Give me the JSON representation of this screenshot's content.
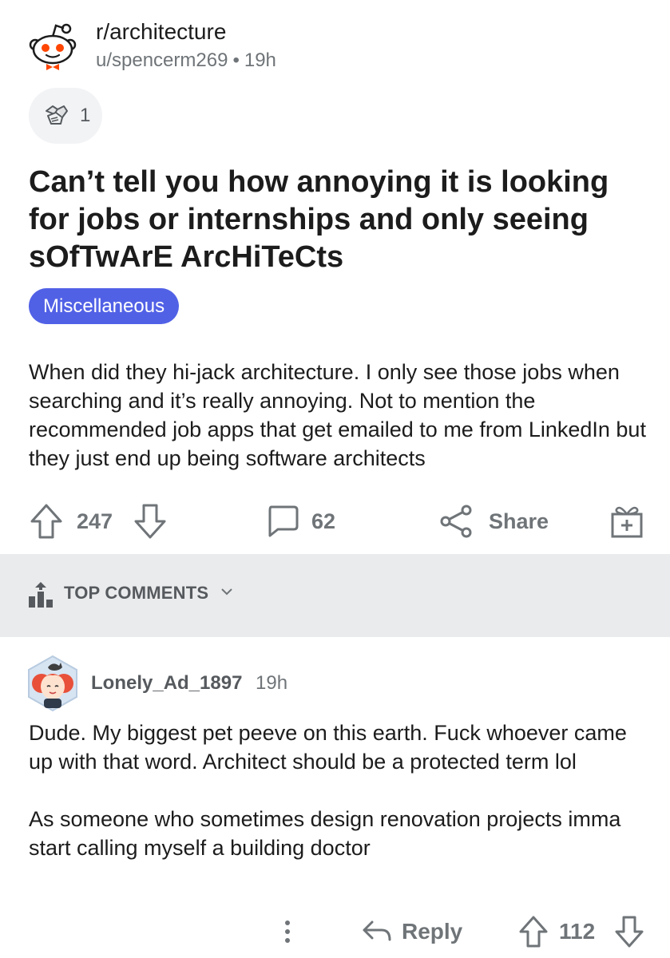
{
  "post": {
    "subreddit": "r/architecture",
    "author": "u/spencerm269",
    "separator": "•",
    "age": "19h",
    "award_count": "1",
    "title": "Can’t tell you how annoying it is looking for jobs or internships and only seeing sOfTwArE ArcHiTeCts",
    "flair": "Miscellaneous",
    "body": "When did they hi-jack architecture. I only see those jobs when searching and it’s really annoying. Not to mention the recommended job apps that get emailed to me from LinkedIn but they just end up being software architects",
    "upvotes": "247",
    "comments": "62",
    "share_label": "Share"
  },
  "comments_section": {
    "sort_label": "TOP COMMENTS"
  },
  "comment": {
    "author": "Lonely_Ad_1897",
    "age": "19h",
    "paragraph1": "Dude. My biggest pet peeve on this earth. Fuck whoever came up with that word. Architect should be a protected term lol",
    "paragraph2": "As someone who sometimes design renovation projects imma start calling myself a building doctor",
    "reply_label": "Reply",
    "upvotes": "112"
  },
  "colors": {
    "flair_bg": "#5161e6",
    "meta_gray": "#6f7478",
    "section_bg": "#eaebec",
    "snoo_red": "#ff4500"
  },
  "icons": {
    "subreddit_avatar": "snoo-icon",
    "award": "award-icon",
    "upvote": "upvote-arrow-icon",
    "downvote": "downvote-arrow-icon",
    "comment": "comment-bubble-icon",
    "share": "share-icon",
    "give_award": "gift-plus-icon",
    "sort": "bar-chart-icon",
    "more": "more-vertical-icon",
    "reply": "reply-arrow-icon"
  }
}
